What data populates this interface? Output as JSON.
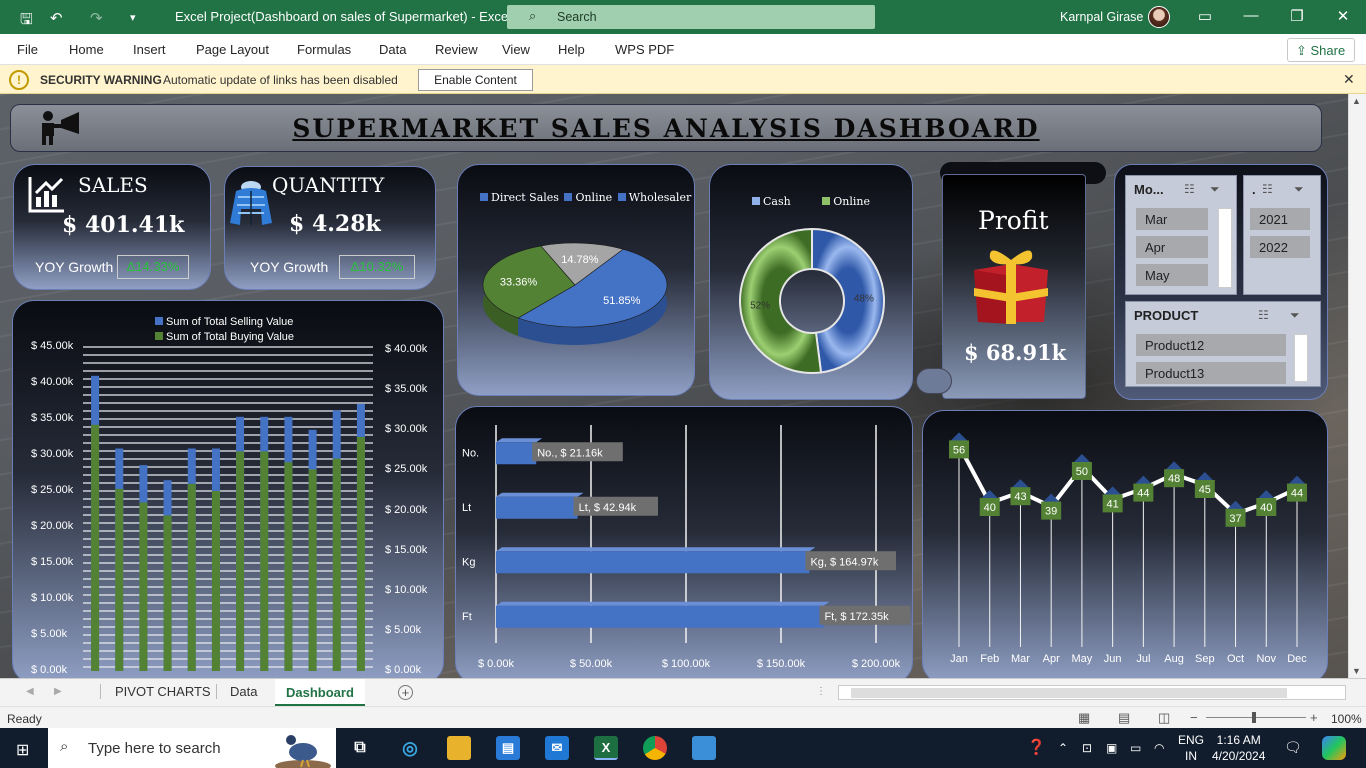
{
  "titlebar": {
    "doc_title": "Excel Project(Dashboard on sales of Supermarket)  -  Excel",
    "search_placeholder": "Search",
    "user": "Karnpal Girase"
  },
  "menu": [
    "File",
    "Home",
    "Insert",
    "Page Layout",
    "Formulas",
    "Data",
    "Review",
    "View",
    "Help",
    "WPS PDF"
  ],
  "share_label": "Share",
  "security": {
    "label": "SECURITY WARNING",
    "message": "Automatic update of links has been disabled",
    "button": "Enable Content"
  },
  "dashboard": {
    "title": "SUPERMARKET SALES ANALYSIS DASHBOARD",
    "sales": {
      "label": "SALES",
      "value": "$ 401.41k",
      "yoy_label": "YOY Growth",
      "yoy_value": "Δ14.33%"
    },
    "quantity": {
      "label": "QUANTITY",
      "value": "$ 4.28k",
      "yoy_label": "YOY Growth",
      "yoy_value": "Δ10.32%"
    },
    "profit": {
      "label": "Profit",
      "value": "$ 68.91k"
    }
  },
  "slicers": {
    "month": {
      "header": "Mo...",
      "items": [
        "Mar",
        "Apr",
        "May"
      ]
    },
    "year": {
      "header": ".",
      "items": [
        "2021",
        "2022"
      ]
    },
    "product": {
      "header": "PRODUCT",
      "items": [
        "Product12",
        "Product13"
      ]
    }
  },
  "chart_data": [
    {
      "type": "bar",
      "subtype": "stacked-column-dual-axis",
      "legend": [
        "Sum of Total Selling Value",
        "Sum of Total Buying Value"
      ],
      "colors": [
        "#4472c4",
        "#548235"
      ],
      "series": [
        {
          "name": "Sum of Total Selling Value",
          "values": [
            41000,
            30900,
            28600,
            26500,
            30900,
            30900,
            35300,
            35300,
            35300,
            33500,
            36200,
            37100
          ]
        },
        {
          "name": "Sum of Total Buying Value",
          "values": [
            34200,
            25300,
            23400,
            21600,
            26000,
            25000,
            30500,
            30500,
            29000,
            28000,
            29500,
            32500
          ]
        }
      ],
      "y_left_ticks": [
        "$ 0.00k",
        "$ 5.00k",
        "$ 10.00k",
        "$ 15.00k",
        "$ 20.00k",
        "$ 25.00k",
        "$ 30.00k",
        "$ 35.00k",
        "$ 40.00k",
        "$ 45.00k"
      ],
      "y_right_ticks": [
        "$ 0.00k",
        "$ 5.00k",
        "$ 10.00k",
        "$ 15.00k",
        "$ 20.00k",
        "$ 25.00k",
        "$ 30.00k",
        "$ 35.00k",
        "$ 40.00k"
      ],
      "ylim_left": [
        0,
        45000
      ],
      "ylim_right": [
        0,
        40000
      ]
    },
    {
      "type": "pie",
      "legend": [
        "Direct Sales",
        "Online",
        "Wholesaler"
      ],
      "values": [
        51.85,
        33.36,
        14.78
      ],
      "labels": [
        "51.85%",
        "33.36%",
        "14.78%"
      ],
      "colors": [
        "#4472c4",
        "#548235",
        "#a5a5a5"
      ]
    },
    {
      "type": "pie",
      "subtype": "doughnut",
      "legend": [
        "Cash",
        "Online"
      ],
      "values": [
        48,
        52
      ],
      "labels": [
        "48%",
        "52%"
      ],
      "colors": [
        "#4472c4",
        "#548235"
      ]
    },
    {
      "type": "bar",
      "subtype": "horizontal",
      "categories": [
        "No.",
        "Lt",
        "Kg",
        "Ft"
      ],
      "values": [
        21160,
        42940,
        164970,
        172350
      ],
      "labels": [
        "No., $ 21.16k",
        "Lt, $ 42.94k",
        "Kg, $ 164.97k",
        "Ft, $ 172.35k"
      ],
      "x_ticks": [
        "$ 0.00k",
        "$ 50.00k",
        "$ 100.00k",
        "$ 150.00k",
        "$ 200.00k"
      ],
      "xlim": [
        0,
        200000
      ],
      "color": "#4472c4"
    },
    {
      "type": "line",
      "categories": [
        "Jan",
        "Feb",
        "Mar",
        "Apr",
        "May",
        "Jun",
        "Jul",
        "Aug",
        "Sep",
        "Oct",
        "Nov",
        "Dec"
      ],
      "values": [
        56,
        40,
        43,
        39,
        50,
        41,
        44,
        48,
        45,
        37,
        40,
        44
      ],
      "labels": [
        "56",
        "40",
        "43",
        "39",
        "50",
        "41",
        "44",
        "48",
        "45",
        "37",
        "40",
        "44"
      ],
      "ylim": [
        0,
        60
      ],
      "color": "#548235"
    }
  ],
  "sheet_tabs": [
    "PIVOT CHARTS",
    "Data",
    "Dashboard"
  ],
  "status": {
    "ready": "Ready",
    "zoom": "100%"
  },
  "taskbar": {
    "search_placeholder": "Type here to search",
    "lang1": "ENG",
    "lang2": "IN",
    "time": "1:16 AM",
    "date": "4/20/2024"
  }
}
